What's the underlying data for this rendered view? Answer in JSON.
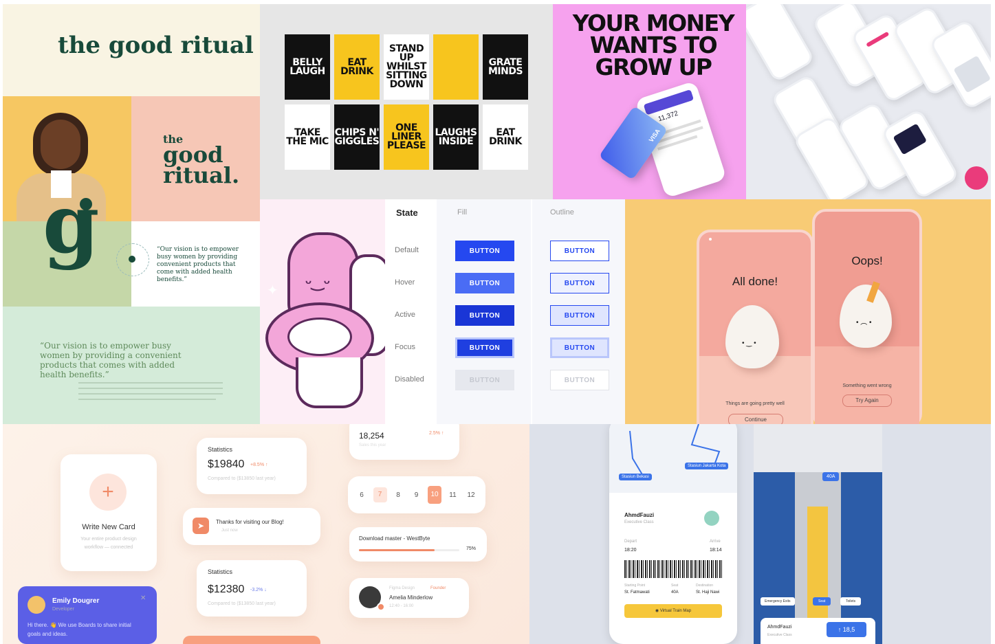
{
  "ritual": {
    "logo_top": "the good ritual",
    "logo_the": "the",
    "logo_good": "good",
    "logo_ritual": "ritual.",
    "monogram": "g",
    "quote_small": "“Our vision is to empower busy women by providing convenient products that come with added health benefits.”",
    "quote_large": "“Our vision is to empower busy women by providing a convenient products that comes with added health benefits.”"
  },
  "posters": [
    {
      "text": "BELLY LAUGH",
      "style": "black"
    },
    {
      "text": "EAT DRINK",
      "style": "yellow"
    },
    {
      "text": "STAND UP WHILST SITTING DOWN",
      "style": "white"
    },
    {
      "text": "",
      "style": "yellow"
    },
    {
      "text": "GRATE MINDS",
      "style": "black"
    },
    {
      "text": "TAKE THE MIC",
      "style": "white"
    },
    {
      "text": "CHIPS N' GIGGLES",
      "style": "black"
    },
    {
      "text": "ONE LINER PLEASE",
      "style": "yellow"
    },
    {
      "text": "LAUGHS INSIDE",
      "style": "black"
    },
    {
      "text": "EAT DRINK",
      "style": "white"
    }
  ],
  "money": {
    "headline_1": "YOUR MONEY",
    "headline_2": "WANTS TO",
    "headline_3": "GROW UP",
    "card_brand": "VISA",
    "balance": "11,372"
  },
  "button_states": {
    "headers": [
      "State",
      "Fill",
      "Outline"
    ],
    "rows": [
      "Default",
      "Hover",
      "Active",
      "Focus",
      "Disabled"
    ],
    "button_label": "BUTTON"
  },
  "egg": {
    "done_title": "All done!",
    "done_caption": "Things are going pretty well",
    "done_button": "Continue",
    "oops_title": "Oops!",
    "oops_caption": "Something went wrong",
    "oops_button": "Try Again"
  },
  "dashboard": {
    "write_card_title": "Write New Card",
    "write_card_sub_1": "Your entire product design",
    "write_card_sub_2": "workflow — connected",
    "stat1_label": "Statistics",
    "stat1_value": "$19840",
    "stat1_change": "+8.5% ↑",
    "stat1_sub": "Compared to ($13850 last year)",
    "stat2_label": "Statistics",
    "stat2_value": "$12380",
    "stat2_change": "-3.2% ↓",
    "stat2_sub": "Compared to ($13850 last year)",
    "blog_title": "Thanks for visiting our Blog!",
    "blog_sub": "Just now",
    "sales_value": "18,254",
    "sales_change": "2.5% ↑",
    "sales_sub": "Sales this year",
    "calendar_days": [
      "6",
      "7",
      "8",
      "9",
      "10",
      "11",
      "12"
    ],
    "download_title": "Download master - WestByte",
    "download_pct": "75%",
    "download_progress": 0.75,
    "person_role": "Figma Design",
    "person_tag": "Founder",
    "person_name": "Amelia Minderlow",
    "person_time": "12:40 - 16:00",
    "chat_name": "Emily Dougrer",
    "chat_role": "Developer",
    "chat_message": "Hi there. 👋 We use Boards to share initial goals and ideas."
  },
  "train": {
    "stop_1": "Stasiun Bekasi",
    "stop_2": "Stasiun Jakarta Kota",
    "passenger": "AhmdFauzi",
    "class": "Executive Class",
    "depart_label": "Depart",
    "depart_time": "18:20",
    "arrive_label": "Arrive",
    "arrive_time": "18:14",
    "from_label": "Starting Point",
    "from": "St. Fatmawati",
    "seat_label": "Seat",
    "seat": "40A",
    "to_label": "Destination",
    "to": "St. Haji Nawi",
    "map_button": "Virtual Train Map",
    "seat_tag": "40A",
    "chip_1": "Emergency Exits",
    "chip_2": "Seat",
    "chip_3": "Toilets",
    "bottom_name": "AhmdFauzi",
    "bottom_class": "Executive Class",
    "bottom_value": "18,5"
  }
}
